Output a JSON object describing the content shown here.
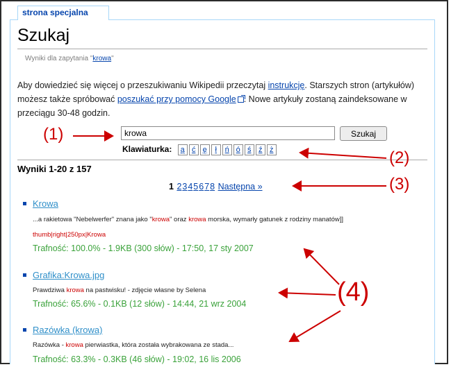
{
  "tab": {
    "label": "strona specjalna"
  },
  "page": {
    "title": "Szukaj",
    "subtitle_prefix": "Wyniki dla zapytania \"",
    "subtitle_query": "krowa",
    "subtitle_suffix": "\""
  },
  "intro": {
    "text1": "Aby dowiedzieć się więcej o przeszukiwaniu Wikipedii przeczytaj ",
    "link1": "instrukcję",
    "text2": ". Starszych stron (artykułów) możesz także spróbować ",
    "link2": "poszukać przy pomocy Google",
    "text3": ". Nowe artykuły zostaną zaindeksowane w przeciągu 30-48 godzin."
  },
  "search": {
    "value": "krowa",
    "button_label": "Szukaj"
  },
  "keyboard": {
    "label": "Klawiaturka:",
    "keys": [
      "ą",
      "ć",
      "ę",
      "ł",
      "ń",
      "ó",
      "ś",
      "ź",
      "ż"
    ]
  },
  "results_header": "Wyniki 1-20 z 157",
  "pager": {
    "current": "1",
    "pages": [
      "2",
      "3",
      "4",
      "5",
      "6",
      "7",
      "8"
    ],
    "next": "Następna »"
  },
  "results": [
    {
      "title": "Krowa",
      "snippet": [
        {
          "t": "...a rakietowa \"Nebelwerfer\" znana jako \"",
          "h": false
        },
        {
          "t": "krowa",
          "h": true
        },
        {
          "t": "\" oraz ",
          "h": false
        },
        {
          "t": "krowa",
          "h": true
        },
        {
          "t": " morska, wymarły gatunek z rodziny manatów]]",
          "h": false
        }
      ],
      "extra": "thumb|right|250px|Krowa",
      "meta": "Trafność: 100.0% - 1.9KB (300 słów) - 17:50, 17 sty 2007"
    },
    {
      "title": "Grafika:Krowa.jpg",
      "snippet": [
        {
          "t": "Prawdziwa ",
          "h": false
        },
        {
          "t": "krowa",
          "h": true
        },
        {
          "t": " na pastwisku! - zdjęcie własne by Selena",
          "h": false
        }
      ],
      "extra": "",
      "meta": "Trafność: 65.6% - 0.1KB (12 słów) - 14:44, 21 wrz 2004"
    },
    {
      "title": "Razówka (krowa)",
      "snippet": [
        {
          "t": "Razówka - ",
          "h": false
        },
        {
          "t": "krowa",
          "h": true
        },
        {
          "t": " pierwiastka, która została wybrakowana ze stada...",
          "h": false
        }
      ],
      "extra": "",
      "meta": "Trafność: 63.3% - 0.3KB (46 słów) - 19:02, 16 lis 2006"
    }
  ],
  "callouts": [
    "(1)",
    "(2)",
    "(3)",
    "(4)"
  ],
  "colors": {
    "link": "#0645ad",
    "highlight": "#cc0000",
    "meta": "#3aa23a",
    "callout": "#cc0000"
  }
}
